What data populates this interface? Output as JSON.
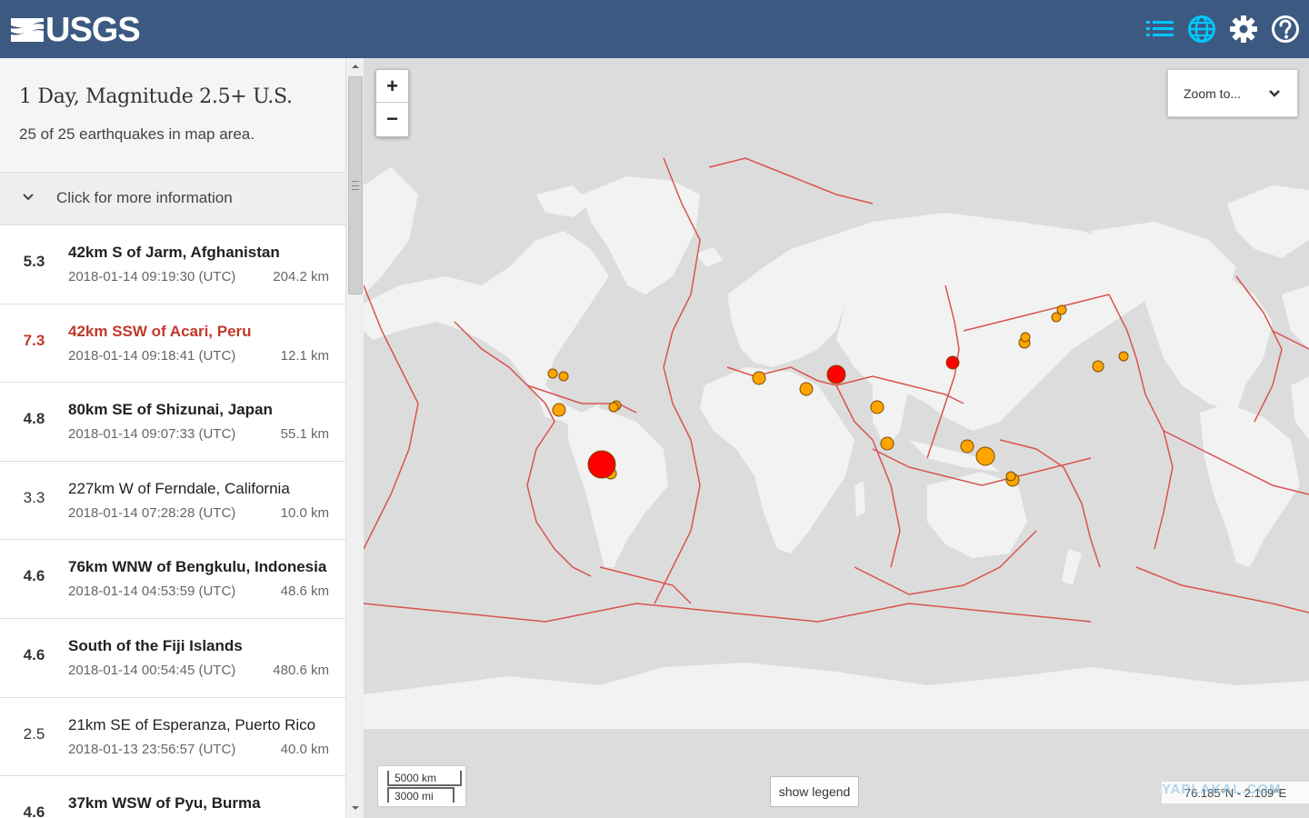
{
  "header": {
    "logo_text": "USGS",
    "icons": [
      "list-icon",
      "globe-icon",
      "gear-icon",
      "help-icon"
    ],
    "accent_color": "#3c5a81",
    "icon_color": "#00c8ff"
  },
  "summary": {
    "title": "1 Day, Magnitude 2.5+ U.S.",
    "subtitle": "25 of 25 earthquakes in map area.",
    "more_info_label": "Click for more information"
  },
  "earthquakes": [
    {
      "mag": "5.3",
      "place": "42km S of Jarm, Afghanistan",
      "time": "2018-01-14 09:19:30 (UTC)",
      "depth": "204.2 km"
    },
    {
      "mag": "7.3",
      "place": "42km SSW of Acari, Peru",
      "time": "2018-01-14 09:18:41 (UTC)",
      "depth": "12.1 km"
    },
    {
      "mag": "4.8",
      "place": "80km SE of Shizunai, Japan",
      "time": "2018-01-14 09:07:33 (UTC)",
      "depth": "55.1 km"
    },
    {
      "mag": "3.3",
      "place": "227km W of Ferndale, California",
      "time": "2018-01-14 07:28:28 (UTC)",
      "depth": "10.0 km"
    },
    {
      "mag": "4.6",
      "place": "76km WNW of Bengkulu, Indonesia",
      "time": "2018-01-14 04:53:59 (UTC)",
      "depth": "48.6 km"
    },
    {
      "mag": "4.6",
      "place": "South of the Fiji Islands",
      "time": "2018-01-14 00:54:45 (UTC)",
      "depth": "480.6 km"
    },
    {
      "mag": "2.5",
      "place": "21km SE of Esperanza, Puerto Rico",
      "time": "2018-01-13 23:56:57 (UTC)",
      "depth": "40.0 km"
    },
    {
      "mag": "4.6",
      "place": "37km WSW of Pyu, Burma",
      "time": "",
      "depth": ""
    }
  ],
  "map": {
    "zoom_in_label": "+",
    "zoom_out_label": "−",
    "zoom_to_label": "Zoom to...",
    "scale_km": "5000 km",
    "scale_mi": "3000 mi",
    "legend_label": "show legend",
    "coordinates": "76.185°N - 2.109°E",
    "watermark": "YAPLAKAL.COM",
    "plate_color": "#d9534f",
    "land_color": "#f2f2f2",
    "ocean_color": "#dcdcdc"
  }
}
